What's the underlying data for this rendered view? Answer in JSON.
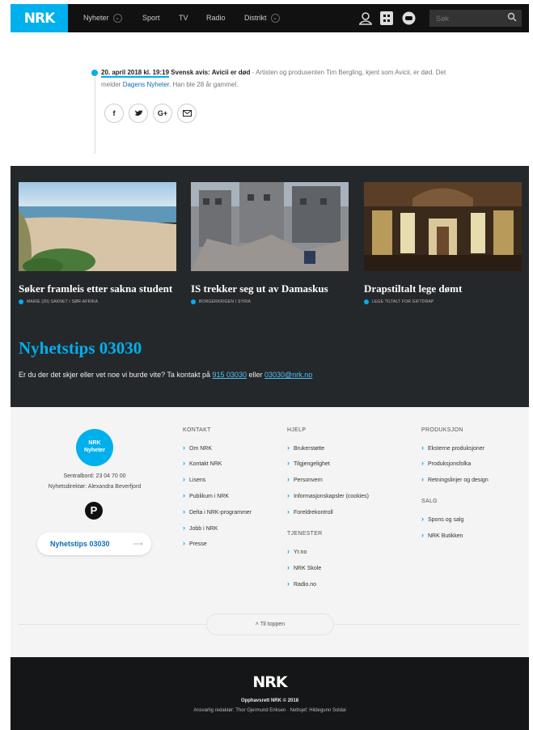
{
  "nav": {
    "logo": "NRK",
    "items": [
      {
        "label": "Nyheter",
        "dropdown": true
      },
      {
        "label": "Sport",
        "dropdown": false
      },
      {
        "label": "TV",
        "dropdown": false
      },
      {
        "label": "Radio",
        "dropdown": false
      },
      {
        "label": "Distrikt",
        "dropdown": true
      }
    ],
    "icons": [
      "user-icon",
      "grid-icon",
      "super-icon"
    ],
    "search_placeholder": "Søk"
  },
  "article": {
    "time": "20. april 2018 kl. 19:19",
    "headline": "Svensk avis: Avicii er død",
    "text_a": " - Artisten og produsenten Tim Bergling, kjent som Avicii, er død. Det melder ",
    "link": "Dagens Nyheter",
    "text_b": ". Han ble 28 år gammel.",
    "share": [
      {
        "name": "facebook-share-button",
        "glyph": "f"
      },
      {
        "name": "twitter-share-button",
        "glyph": "t"
      },
      {
        "name": "googleplus-share-button",
        "glyph": "G+"
      },
      {
        "name": "email-share-button",
        "glyph": "✉"
      }
    ]
  },
  "cards": [
    {
      "title": "Søker framleis etter sakna student",
      "tag": "MARIE (20) SAKNET I SØR-AFRIKA",
      "image": "beach-photo"
    },
    {
      "title": "IS trekker seg ut av Damaskus",
      "tag": "BORGERKRIGEN I SYRIA",
      "image": "ruins-photo"
    },
    {
      "title": "Drapstiltalt lege dømt",
      "tag": "LEGE TILTALT FOR GIFTDRAP",
      "image": "courthouse-photo"
    }
  ],
  "tips": {
    "title": "Nyhetstips 03030",
    "text_a": "Er du der det skjer eller vet noe vi burde vite? Ta kontakt på ",
    "phone": "915 03030",
    "text_b": " eller ",
    "email": "03030@nrk.no"
  },
  "footer": {
    "logo_line1": "NRK",
    "logo_line2": "Nyheter",
    "switchboard": "Sentralbord: 23 04 70 00",
    "director": "Nyhetsdirektør: Alexandra Beverfjord",
    "tips_button": "Nyhetstips 03030",
    "kontakt": {
      "head": "KONTAKT",
      "items": [
        "Om NRK",
        "Kontakt NRK",
        "Lisens",
        "Publikum i NRK",
        "Delta i NRK-programmer",
        "Jobb i NRK",
        "Presse"
      ]
    },
    "hjelp": {
      "head": "HJELP",
      "items": [
        "Brukerstøtte",
        "Tilgjengelighet",
        "Personvern",
        "Informasjonskapsler (cookies)",
        "Foreldrekontroll"
      ]
    },
    "tjenester": {
      "head": "TJENESTER",
      "items": [
        "Yr.no",
        "NRK Skole",
        "Radio.no"
      ]
    },
    "produksjon": {
      "head": "PRODUKSJON",
      "items": [
        "Eksterne produksjoner",
        "Produksjonsfolka",
        "Retningslinjer og design"
      ]
    },
    "salg": {
      "head": "SALG",
      "items": [
        "Spons og salg",
        "NRK Butikken"
      ]
    },
    "to_top": "Til toppen"
  },
  "bottom": {
    "logo": "NRK",
    "copyright": "Opphavsrett NRK © 2018",
    "editors": "Ansvarlig redaktør: Thor Gjermund Eriksen · Nettsjef: Hildegunn Soldal"
  },
  "colors": {
    "accent": "#00b0ec",
    "dark": "#25282b",
    "footer": "#f4f4f4",
    "bottom": "#151617"
  }
}
